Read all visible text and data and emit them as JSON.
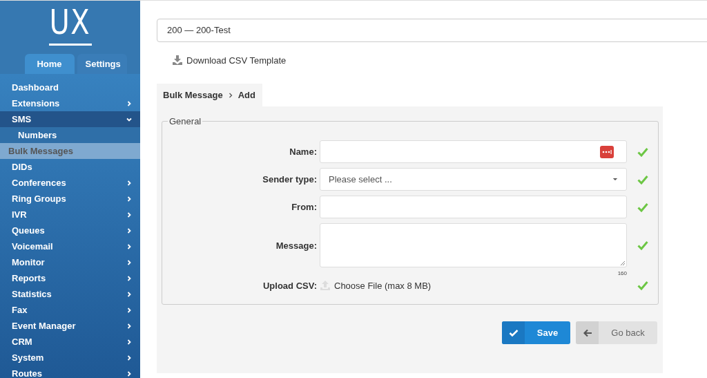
{
  "logo": {
    "text": "UX"
  },
  "sidebar": {
    "tabs": [
      {
        "label": "Home",
        "selected": true
      },
      {
        "label": "Settings",
        "selected": false
      }
    ],
    "items": [
      {
        "label": "Dashboard",
        "has_submenu": false,
        "expanded": false,
        "selected": false
      },
      {
        "label": "Extensions",
        "has_submenu": true,
        "expanded": false,
        "selected": false
      },
      {
        "label": "SMS",
        "has_submenu": true,
        "expanded": true,
        "selected": false,
        "children": [
          {
            "label": "Numbers",
            "selected": false
          },
          {
            "label": "Bulk Messages",
            "selected": true
          }
        ]
      },
      {
        "label": "DIDs",
        "has_submenu": false,
        "expanded": false,
        "selected": false
      },
      {
        "label": "Conferences",
        "has_submenu": true,
        "expanded": false,
        "selected": false
      },
      {
        "label": "Ring Groups",
        "has_submenu": true,
        "expanded": false,
        "selected": false
      },
      {
        "label": "IVR",
        "has_submenu": true,
        "expanded": false,
        "selected": false
      },
      {
        "label": "Queues",
        "has_submenu": true,
        "expanded": false,
        "selected": false
      },
      {
        "label": "Voicemail",
        "has_submenu": true,
        "expanded": false,
        "selected": false
      },
      {
        "label": "Monitor",
        "has_submenu": true,
        "expanded": false,
        "selected": false
      },
      {
        "label": "Reports",
        "has_submenu": true,
        "expanded": false,
        "selected": false
      },
      {
        "label": "Statistics",
        "has_submenu": true,
        "expanded": false,
        "selected": false
      },
      {
        "label": "Fax",
        "has_submenu": true,
        "expanded": false,
        "selected": false
      },
      {
        "label": "Event Manager",
        "has_submenu": true,
        "expanded": false,
        "selected": false
      },
      {
        "label": "CRM",
        "has_submenu": true,
        "expanded": false,
        "selected": false
      },
      {
        "label": "System",
        "has_submenu": true,
        "expanded": false,
        "selected": false
      },
      {
        "label": "Routes",
        "has_submenu": true,
        "expanded": false,
        "selected": false
      }
    ]
  },
  "tenant_select": {
    "value": "200  —  200-Test"
  },
  "download_link": {
    "label": "Download CSV Template"
  },
  "breadcrumb": [
    "Bulk Message",
    "Add"
  ],
  "form": {
    "legend": "General",
    "fields": [
      {
        "kind": "text",
        "label": "Name:",
        "valid": true
      },
      {
        "kind": "select",
        "label": "Sender type:",
        "placeholder": "Please select ...",
        "valid": true
      },
      {
        "kind": "text",
        "label": "From:",
        "valid": true
      },
      {
        "kind": "textarea",
        "label": "Message:",
        "counter": "160",
        "valid": true
      },
      {
        "kind": "file",
        "label": "Upload CSV:",
        "button": "Choose File (max 8 MB)",
        "valid": true
      }
    ]
  },
  "buttons": [
    {
      "kind": "primary",
      "label": "Save"
    },
    {
      "kind": "back",
      "label": "Go back"
    }
  ]
}
